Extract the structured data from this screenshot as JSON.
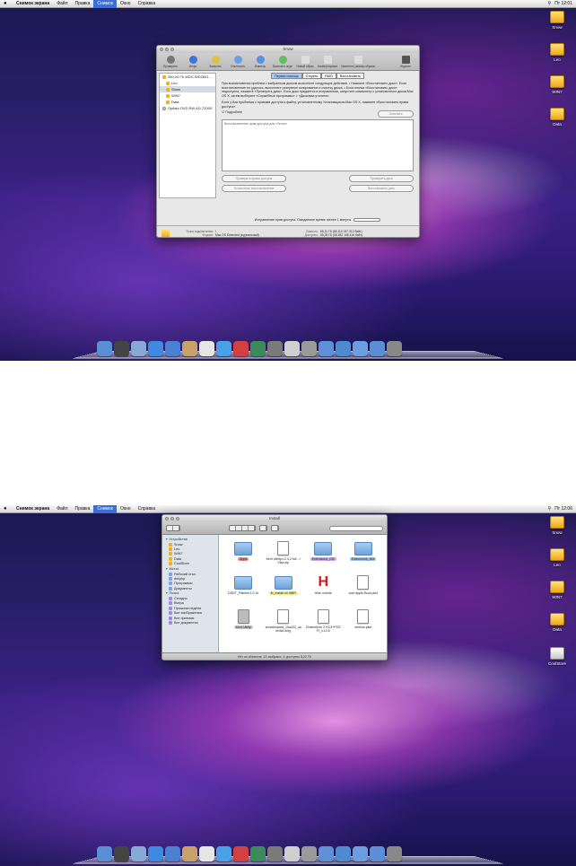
{
  "menubar": {
    "apple": "",
    "items": [
      "Снимок экрана",
      "Файл",
      "Правка",
      "Снимок",
      "Окно",
      "Справка"
    ],
    "clock_top": "Пт 12:01",
    "clock_bottom": "Пт 12:06"
  },
  "desktop_top": {
    "drives": [
      "Snow",
      "Leo",
      "WIN7",
      "Data"
    ]
  },
  "desktop_bottom": {
    "drives": [
      "Snow",
      "Leo",
      "WIN7",
      "Data",
      "CoolStore"
    ]
  },
  "disk_utility": {
    "title": "Snow",
    "toolbar": [
      "Проверить",
      "Инфо",
      "Записать",
      "Отключить",
      "Извлечь",
      "Включить журнал",
      "Новый образ",
      "Конвертировать",
      "Изменить размер образа",
      "Журнал"
    ],
    "disks": [
      {
        "label": "260,04 ГБ WDC WD2601...",
        "indent": false,
        "kind": "disk",
        "selected": false
      },
      {
        "label": "Leo",
        "indent": true,
        "kind": "vol",
        "selected": false
      },
      {
        "label": "Snow",
        "indent": true,
        "kind": "vol",
        "selected": true
      },
      {
        "label": "WIN7",
        "indent": true,
        "kind": "vol",
        "selected": false
      },
      {
        "label": "Data",
        "indent": true,
        "kind": "vol",
        "selected": false
      },
      {
        "label": "Optiarc DVD RW AD-7200S",
        "indent": false,
        "kind": "disc",
        "selected": false
      }
    ],
    "tabs": [
      "Первая помощь",
      "Стереть",
      "RAID",
      "Восстановить"
    ],
    "help_text": "При возникновении проблем с выбранным диском выполните следующие действия. • Нажмите «Восстановить диск». Если восстановление не удалось, выполните резервное копирование и очистку диска. • Если кнопка «Восстановить диск» недоступна, нажмите «Проверить диск». Если диск нуждается в исправлении, запустите компьютер с установочного диска Mac OS X, затем выберите «Служебные программы» > «Дисковая утилита».",
    "help_text2": "Если у Вас проблемы с правами доступа к файлу, установленному Установщиком Mac OS X, нажмите «Восстановить права доступа».",
    "details_checkbox": "Подробнее",
    "clear_button": "Очистить",
    "log_text": "Восстановление прав доступа для «Snow»",
    "buttons_left": [
      "Проверить права доступа",
      "Остановить восстановление"
    ],
    "buttons_right": [
      "Проверить диск",
      "Восстановить диск"
    ],
    "progress_text": "Исправление прав доступа. Ожидаемое время: менее 1 минуты",
    "info_left": [
      {
        "k": "Точка подключения:",
        "v": "/"
      },
      {
        "k": "Формат:",
        "v": "Mac OS Extended (журнальный)"
      },
      {
        "k": "Владельцы включены:",
        "v": "Да"
      },
      {
        "k": "Количество папок:",
        "v": "59 579"
      }
    ],
    "info_right": [
      {
        "k": "Емкость:",
        "v": "85,11 ГБ (85 110 157 312 байт)"
      },
      {
        "k": "Доступно:",
        "v": "55,28 ГБ (55 282 108 416 байт)"
      },
      {
        "k": "Занято:",
        "v": "2,76 ГБ (2 761 728 000 байт)"
      },
      {
        "k": "Количество файлов:",
        "v": "211 154"
      }
    ]
  },
  "finder": {
    "title": "Install",
    "sidebar": [
      {
        "head": "▼ Устройства",
        "items": [
          "Snow",
          "Leo",
          "WIN7",
          "Data",
          "CoolStore"
        ]
      },
      {
        "head": "▼ Места",
        "items": [
          "Рабочий стол",
          "dmlyhp",
          "Программы",
          "Документы"
        ]
      },
      {
        "head": "▼ Поиск",
        "items": [
          "Сегодня",
          "Вчера",
          "Прошлая неделя",
          "Все изображения",
          "Все фильмы",
          "Все документы"
        ]
      }
    ],
    "files": [
      {
        "name": "Apps",
        "type": "folder",
        "tag": "red"
      },
      {
        "name": "Kext Utility.v.2.4.2.full - rVlad.zip",
        "type": "file",
        "tag": ""
      },
      {
        "name": "Extensions_x32",
        "type": "folder",
        "tag": "purple"
      },
      {
        "name": "Extensions_x64",
        "type": "folder",
        "tag": "blue"
      },
      {
        "name": "DSDT_Patcher1.0.1e",
        "type": "folder",
        "tag": ""
      },
      {
        "name": "Ib_Install on MBR",
        "type": "folder",
        "tag": "yellow"
      },
      {
        "name": "Hide unhide",
        "type": "hide",
        "tag": ""
      },
      {
        "name": "com.apple.Boot.plist",
        "type": "file",
        "tag": ""
      },
      {
        "name": "Kext Utility",
        "type": "app",
        "tag": "gray"
      },
      {
        "name": "snowleopard_10a432_userdvd.dmg",
        "type": "file",
        "tag": ""
      },
      {
        "name": "Chameleon 2 RC3+PCEFI_v.10.5",
        "type": "file",
        "tag": ""
      },
      {
        "name": "smbios.plist",
        "type": "file",
        "tag": ""
      }
    ],
    "status": "Нет из объектов: 12; выбрано: 1; доступно 5,22 ГБ"
  },
  "dock_colors": [
    "#5a8fd6",
    "#444",
    "#88a9d6",
    "#3d8be0",
    "#4a7fd2",
    "#c9a26a",
    "#e6e6e6",
    "#4aa0e6",
    "#d24040",
    "#3a8a5a",
    "#7a7a7a",
    "#cfcfcf",
    "#9a9a9a",
    "#5e90d8",
    "#4e8ad0",
    "#6a9ee0",
    "#5a8fd6",
    "#888"
  ]
}
